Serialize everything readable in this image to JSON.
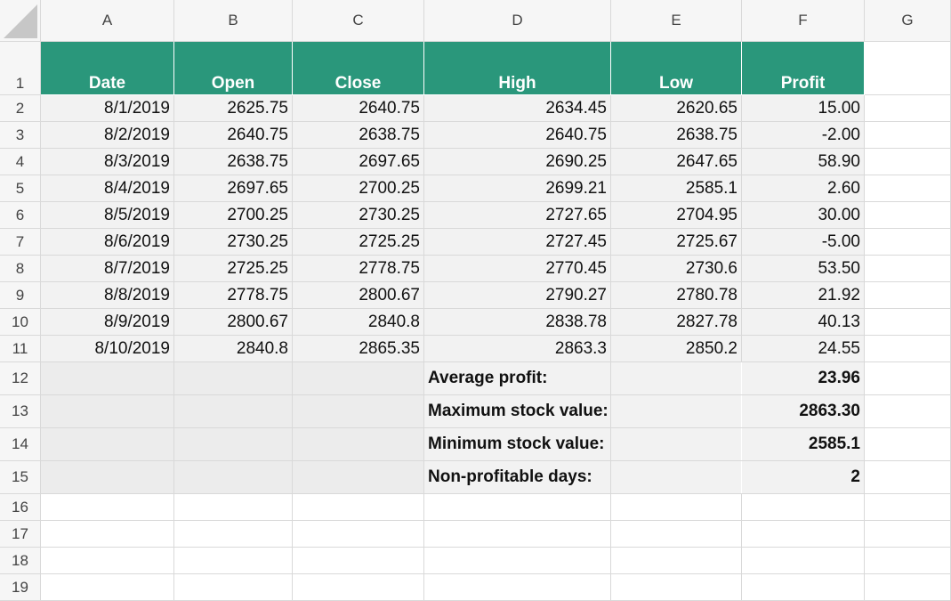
{
  "columns": [
    "A",
    "B",
    "C",
    "D",
    "E",
    "F",
    "G"
  ],
  "rows": [
    "1",
    "2",
    "3",
    "4",
    "5",
    "6",
    "7",
    "8",
    "9",
    "10",
    "11",
    "12",
    "13",
    "14",
    "15",
    "16",
    "17",
    "18",
    "19"
  ],
  "header": [
    "Date",
    "Open",
    "Close",
    "High",
    "Low",
    "Profit"
  ],
  "data": [
    [
      "8/1/2019",
      "2625.75",
      "2640.75",
      "2634.45",
      "2620.65",
      "15.00"
    ],
    [
      "8/2/2019",
      "2640.75",
      "2638.75",
      "2640.75",
      "2638.75",
      "-2.00"
    ],
    [
      "8/3/2019",
      "2638.75",
      "2697.65",
      "2690.25",
      "2647.65",
      "58.90"
    ],
    [
      "8/4/2019",
      "2697.65",
      "2700.25",
      "2699.21",
      "2585.1",
      "2.60"
    ],
    [
      "8/5/2019",
      "2700.25",
      "2730.25",
      "2727.65",
      "2704.95",
      "30.00"
    ],
    [
      "8/6/2019",
      "2730.25",
      "2725.25",
      "2727.45",
      "2725.67",
      "-5.00"
    ],
    [
      "8/7/2019",
      "2725.25",
      "2778.75",
      "2770.45",
      "2730.6",
      "53.50"
    ],
    [
      "8/8/2019",
      "2778.75",
      "2800.67",
      "2790.27",
      "2780.78",
      "21.92"
    ],
    [
      "8/9/2019",
      "2800.67",
      "2840.8",
      "2838.78",
      "2827.78",
      "40.13"
    ],
    [
      "8/10/2019",
      "2840.8",
      "2865.35",
      "2863.3",
      "2850.2",
      "24.55"
    ]
  ],
  "summary": [
    {
      "label": "Average profit:",
      "value": "23.96"
    },
    {
      "label": "Maximum stock value:",
      "value": "2863.30"
    },
    {
      "label": "Minimum stock value:",
      "value": "2585.1"
    },
    {
      "label": "Non-profitable days:",
      "value": "2"
    }
  ],
  "colors": {
    "header_bg": "#2a977b",
    "header_text": "#ffffff",
    "cell_bg": "#f2f2f2"
  }
}
